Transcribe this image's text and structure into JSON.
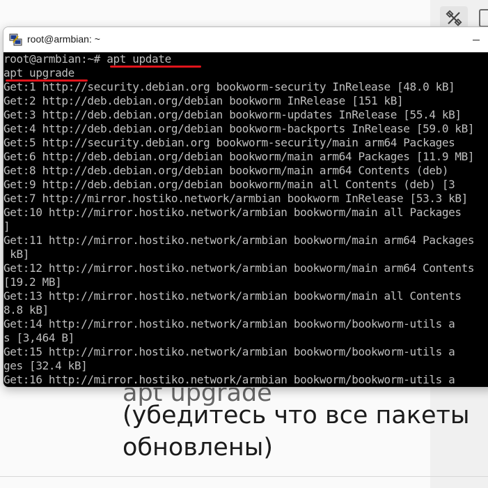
{
  "document": {
    "line1": "apt upgrade",
    "line2": "(убедитесь что все пакеты",
    "line3": "обновлены)"
  },
  "window": {
    "title": "root@armbian: ~",
    "icon": "putty-icon"
  },
  "terminal": {
    "lines": [
      "root@armbian:~# apt update",
      "apt upgrade",
      "Get:1 http://security.debian.org bookworm-security InRelease [48.0 kB]",
      "Get:2 http://deb.debian.org/debian bookworm InRelease [151 kB]",
      "Get:3 http://deb.debian.org/debian bookworm-updates InRelease [55.4 kB]",
      "Get:4 http://deb.debian.org/debian bookworm-backports InRelease [59.0 kB]",
      "Get:5 http://security.debian.org bookworm-security/main arm64 Packages",
      "Get:6 http://deb.debian.org/debian bookworm/main arm64 Packages [11.9 MB]",
      "Get:8 http://deb.debian.org/debian bookworm/main arm64 Contents (deb)",
      "Get:9 http://deb.debian.org/debian bookworm/main all Contents (deb) [3",
      "Get:7 http://mirror.hostiko.network/armbian bookworm InRelease [53.3 kB]",
      "Get:10 http://mirror.hostiko.network/armbian bookworm/main all Packages",
      "]",
      "Get:11 http://mirror.hostiko.network/armbian bookworm/main arm64 Packages",
      " kB]",
      "Get:12 http://mirror.hostiko.network/armbian bookworm/main arm64 Contents",
      "[19.2 MB]",
      "Get:13 http://mirror.hostiko.network/armbian bookworm/main all Contents",
      "8.8 kB]",
      "Get:14 http://mirror.hostiko.network/armbian bookworm/bookworm-utils a",
      "s [3,464 B]",
      "Get:15 http://mirror.hostiko.network/armbian bookworm/bookworm-utils a",
      "ges [32.4 kB]",
      "Get:16 http://mirror.hostiko.network/armbian bookworm/bookworm-utils a"
    ]
  },
  "colors": {
    "terminal_bg": "#000000",
    "terminal_fg": "#bfbfbf",
    "annotation_red": "#e0141b"
  }
}
